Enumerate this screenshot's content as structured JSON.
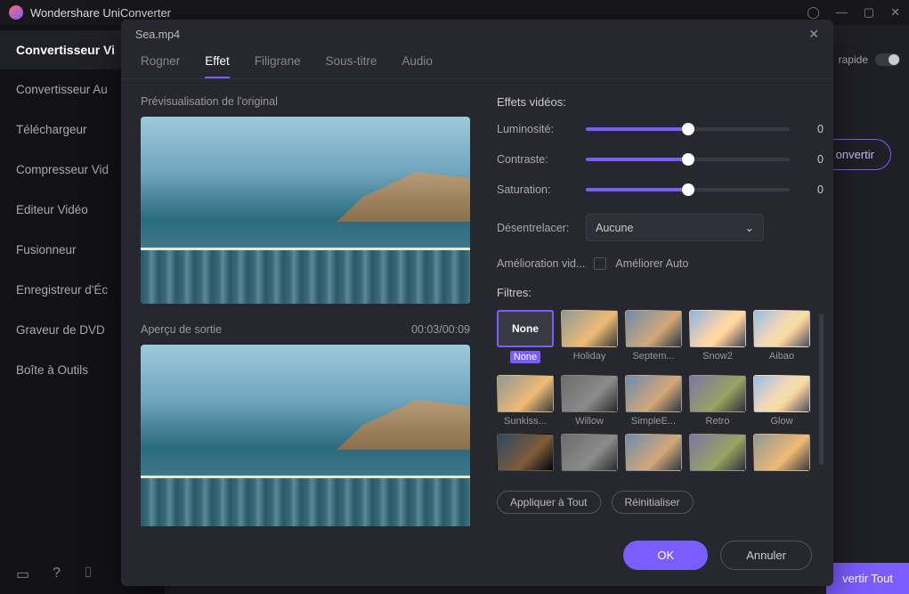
{
  "app": {
    "title": "Wondershare UniConverter"
  },
  "sidebar": {
    "active": "Convertisseur Vi",
    "items": [
      "Convertisseur Au",
      "Téléchargeur",
      "Compresseur Vid",
      "Editeur Vidéo",
      "Fusionneur",
      "Enregistreur d'Éc",
      "Graveur de DVD",
      "Boîte à Outils"
    ]
  },
  "background": {
    "rapid": "rapide",
    "convert": "onvertir",
    "convert_all": "vertir Tout"
  },
  "modal": {
    "filename": "Sea.mp4",
    "tabs": {
      "crop": "Rogner",
      "effect": "Effet",
      "watermark": "Filigrane",
      "subtitle": "Sous-titre",
      "audio": "Audio"
    },
    "preview": {
      "original_label": "Prévisualisation de l'original",
      "output_label": "Aperçu de sortie",
      "time": "00:03/00:09"
    },
    "effects": {
      "title": "Effets vidéos:",
      "brightness": {
        "label": "Luminosité:",
        "value": "0"
      },
      "contrast": {
        "label": "Contraste:",
        "value": "0"
      },
      "saturation": {
        "label": "Saturation:",
        "value": "0"
      },
      "deinterlace": {
        "label": "Désentrelacer:",
        "selected": "Aucune"
      },
      "enhance": {
        "label": "Amélioration vid...",
        "option": "Améliorer Auto"
      }
    },
    "filters": {
      "label": "Filtres:",
      "none_thumb": "None",
      "items": [
        [
          "None",
          "Holiday",
          "Septem...",
          "Snow2",
          "Aibao"
        ],
        [
          "Sunkiss...",
          "Willow",
          "SimpleE...",
          "Retro",
          "Glow"
        ],
        [
          "",
          "",
          "",
          "",
          ""
        ]
      ],
      "apply_all": "Appliquer à Tout",
      "reset": "Réinitialiser"
    },
    "buttons": {
      "ok": "OK",
      "cancel": "Annuler"
    }
  }
}
